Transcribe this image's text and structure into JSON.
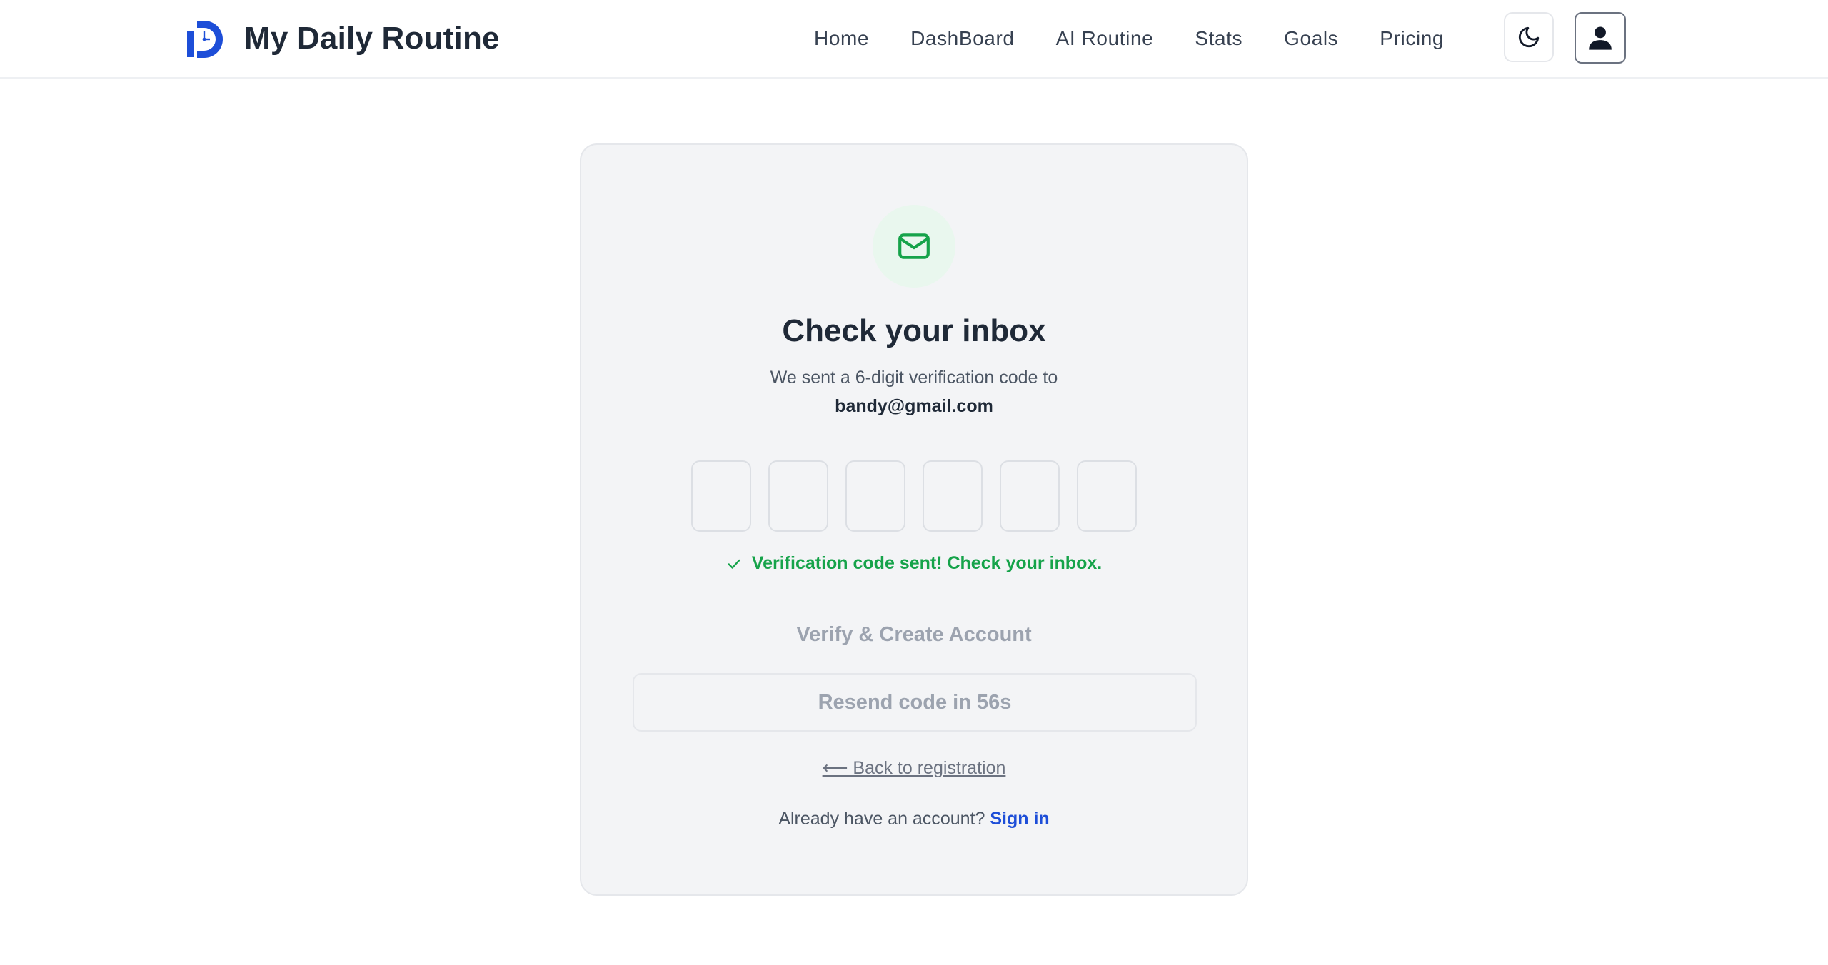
{
  "header": {
    "brand_name": "My Daily Routine",
    "nav": [
      "Home",
      "DashBoard",
      "AI Routine",
      "Stats",
      "Goals",
      "Pricing"
    ]
  },
  "card": {
    "title": "Check your inbox",
    "subtitle": "We sent a 6-digit verification code to",
    "email": "bandy@gmail.com",
    "code_digits": [
      "",
      "",
      "",
      "",
      "",
      ""
    ],
    "status_message": "Verification code sent! Check your inbox.",
    "verify_label": "Verify & Create Account",
    "resend_label": "Resend code in 56s",
    "back_label": "⟵ Back to registration",
    "signin_prompt": "Already have an account?",
    "signin_label": "Sign in"
  },
  "colors": {
    "brand_blue": "#1d4ed8",
    "success_green": "#16a34a",
    "card_bg": "#f3f4f6",
    "muted_text": "#9ca3af"
  },
  "icons": {
    "logo": "clock-d-logo-icon",
    "theme": "moon-icon",
    "account": "user-icon",
    "mail": "mail-icon",
    "status": "check-icon"
  }
}
